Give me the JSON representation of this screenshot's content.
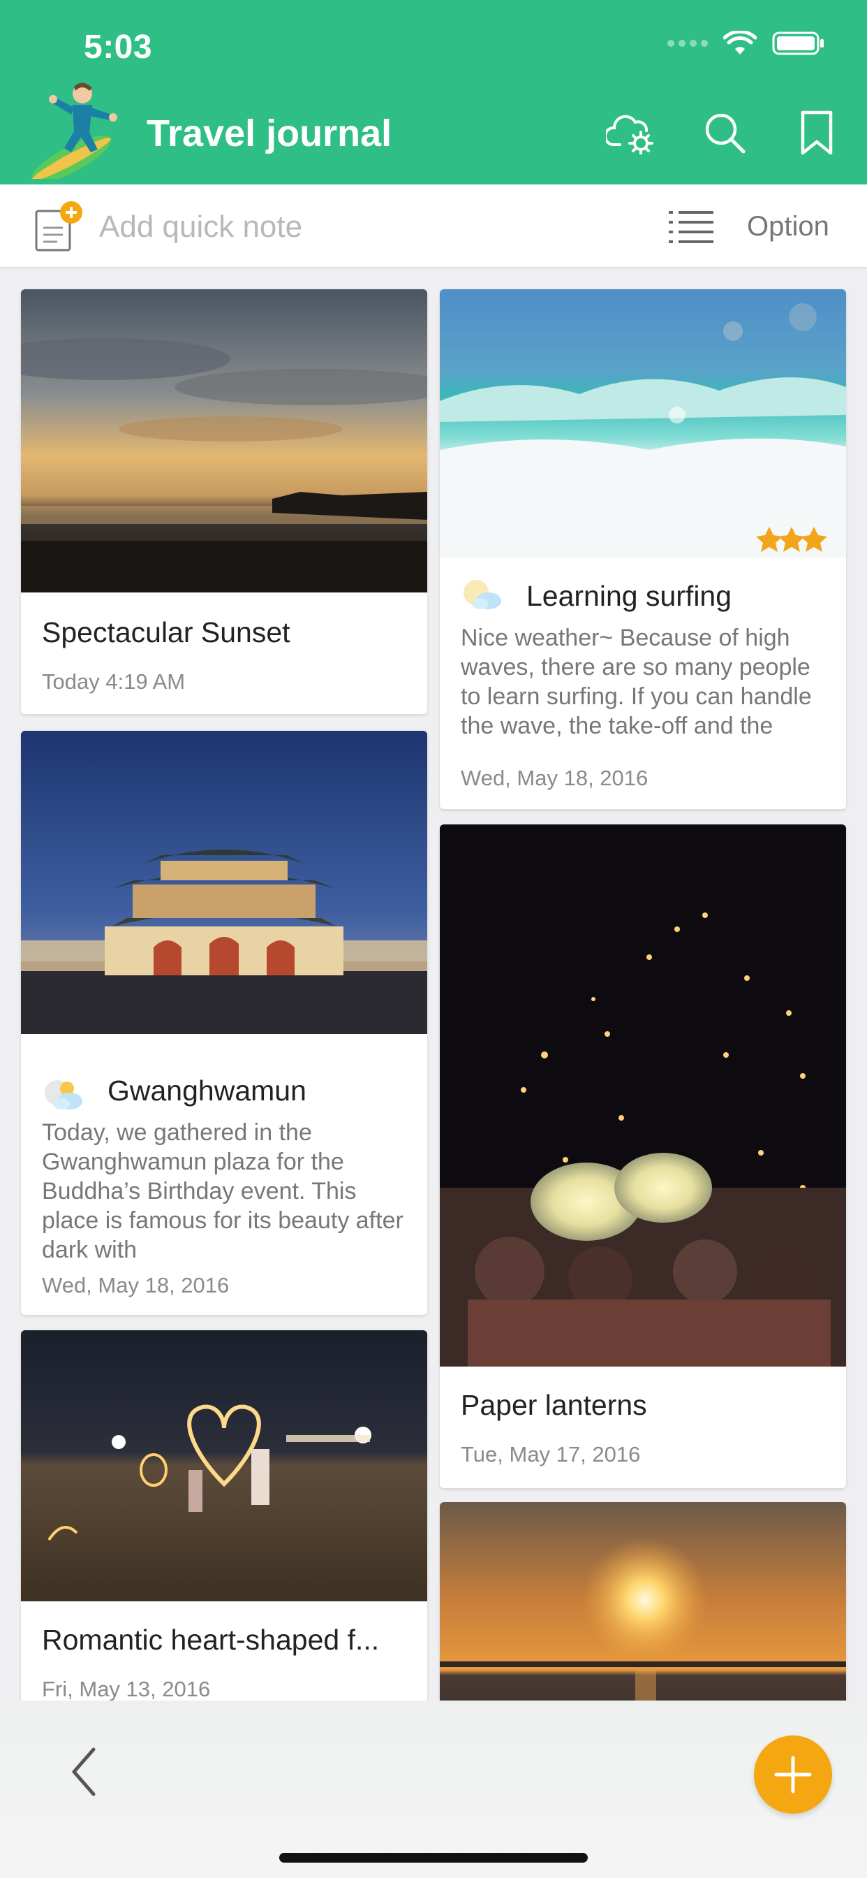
{
  "status_bar": {
    "time": "5:03"
  },
  "header": {
    "title": "Travel journal",
    "icons": [
      "cloud-settings-icon",
      "search-icon",
      "bookmark-icon"
    ],
    "accent_color": "#2fbf86"
  },
  "quick_note": {
    "placeholder": "Add quick note",
    "option_label": "Option"
  },
  "entries": [
    {
      "title": "Spectacular Sunset",
      "date": "Today 4:19 AM",
      "photo": "sunset over beach"
    },
    {
      "title": "Learning surfing",
      "weather": "sunny-cloudy",
      "rating_stars": 3,
      "snippet": "Nice weather~ Because of high waves, there are so many people to learn surfing. If you can handle the wave, the take-off and the",
      "date": "Wed, May 18, 2016",
      "photo": "waves"
    },
    {
      "title": "Gwanghwamun",
      "weather": "night-cloudy",
      "snippet": "Today, we gathered in the Gwanghwamun plaza for the Buddha’s Birthday event. This place is famous for its beauty after dark with",
      "date": "Wed, May 18, 2016",
      "photo": "palace gate at night"
    },
    {
      "title": "Paper lanterns",
      "date": "Tue, May 17, 2016",
      "photo": "sky lanterns at night"
    },
    {
      "title": "Romantic heart-shaped f...",
      "date": "Fri, May 13, 2016",
      "photo": "sparkler heart on beach"
    },
    {
      "title": "",
      "date": "",
      "photo": "sun over sea"
    }
  ],
  "fab": {
    "icon": "plus-icon",
    "color": "#f5a711"
  }
}
